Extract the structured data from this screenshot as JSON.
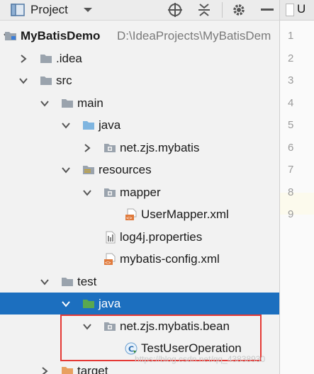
{
  "toolbar": {
    "title": "Project",
    "icons": [
      "project-view-icon",
      "dropdown-chevron-icon",
      "locate-crosshair-icon",
      "collapse-all-icon",
      "settings-gear-icon",
      "hide-minus-icon"
    ]
  },
  "tree": [
    {
      "label": "MyBatisDemo",
      "path": "D:\\IdeaProjects\\MyBatisDem",
      "icon": "module-folder-icon",
      "expanded": true
    },
    {
      "label": ".idea",
      "icon": "folder-icon",
      "expanded": false
    },
    {
      "label": "src",
      "icon": "folder-icon",
      "expanded": true
    },
    {
      "label": "main",
      "icon": "folder-icon",
      "expanded": true
    },
    {
      "label": "java",
      "icon": "source-folder-icon",
      "expanded": true
    },
    {
      "label": "net.zjs.mybatis",
      "icon": "package-icon",
      "expanded": false
    },
    {
      "label": "resources",
      "icon": "resources-folder-icon",
      "expanded": true
    },
    {
      "label": "mapper",
      "icon": "package-icon",
      "expanded": true
    },
    {
      "label": "UserMapper.xml",
      "icon": "xml-file-icon"
    },
    {
      "label": "log4j.properties",
      "icon": "properties-file-icon"
    },
    {
      "label": "mybatis-config.xml",
      "icon": "xml-file-icon"
    },
    {
      "label": "test",
      "icon": "folder-icon",
      "expanded": true
    },
    {
      "label": "java",
      "icon": "test-source-folder-icon",
      "expanded": true,
      "selected": true
    },
    {
      "label": "net.zjs.mybatis.bean",
      "icon": "package-icon",
      "expanded": true
    },
    {
      "label": "TestUserOperation",
      "icon": "java-class-icon"
    },
    {
      "label": "target",
      "icon": "excluded-folder-icon",
      "expanded": false
    }
  ],
  "editor": {
    "tab_label": "U",
    "line_numbers": [
      "1",
      "2",
      "3",
      "4",
      "5",
      "6",
      "7",
      "8",
      "9"
    ]
  },
  "watermark": "https://blog.csdn.net/qq_43838930",
  "colors": {
    "selection": "#1c6fbf",
    "highlight_border": "#e53935",
    "folder": "#9aa3ad",
    "source_folder": "#7fb5e0",
    "test_folder": "#5aa84f"
  }
}
